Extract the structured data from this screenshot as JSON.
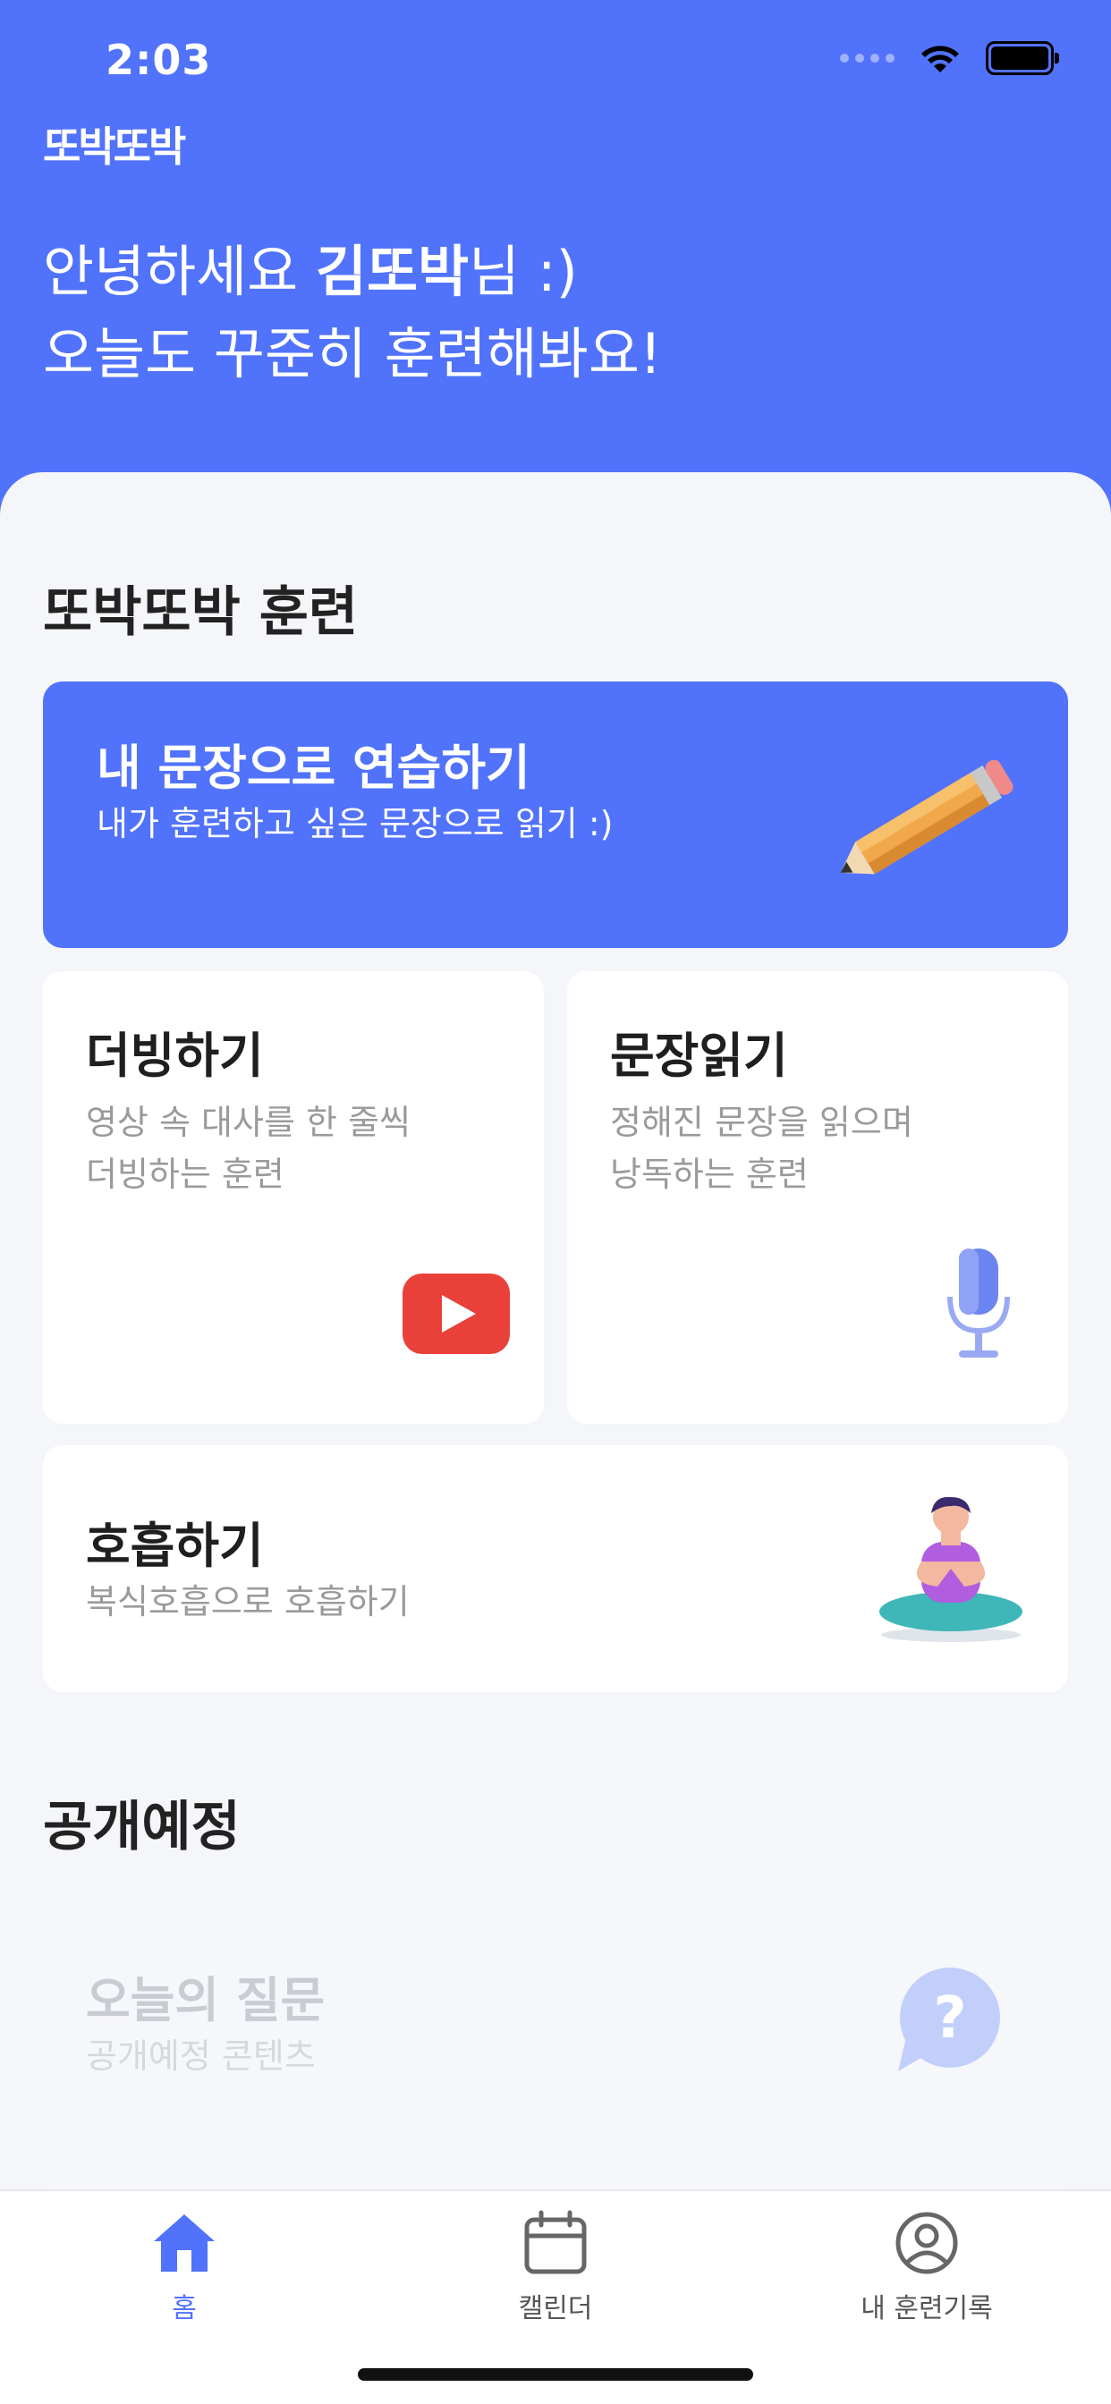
{
  "status": {
    "time": "2:03"
  },
  "app": {
    "logo": "또박또박"
  },
  "greeting": {
    "prefix": "안녕하세요 ",
    "name": "김또박",
    "suffix": "님 :)",
    "line2": "오늘도 꾸준히 훈련해봐요!"
  },
  "training": {
    "section_title": "또박또박 훈련",
    "custom": {
      "title": "내 문장으로 연습하기",
      "subtitle": "내가 훈련하고 싶은 문장으로 읽기 :)"
    },
    "dubbing": {
      "title": "더빙하기",
      "line1": "영상 속 대사를 한 줄씩",
      "line2": "더빙하는 훈련"
    },
    "reading": {
      "title": "문장읽기",
      "line1": "정해진 문장을 읽으며",
      "line2": "낭독하는 훈련"
    },
    "breathing": {
      "title": "호흡하기",
      "subtitle": "복식호흡으로 호흡하기"
    }
  },
  "upcoming": {
    "section_title": "공개예정",
    "question": {
      "title": "오늘의 질문",
      "subtitle": "공개예정 콘텐츠"
    }
  },
  "tabbar": {
    "items": [
      {
        "label": "홈",
        "icon": "home-icon"
      },
      {
        "label": "캘린더",
        "icon": "calendar-icon"
      },
      {
        "label": "내 훈련기록",
        "icon": "profile-icon"
      }
    ],
    "active_color": "#5173fb"
  },
  "colors": {
    "brand": "#5173fb",
    "background": "#f4f6fa"
  }
}
